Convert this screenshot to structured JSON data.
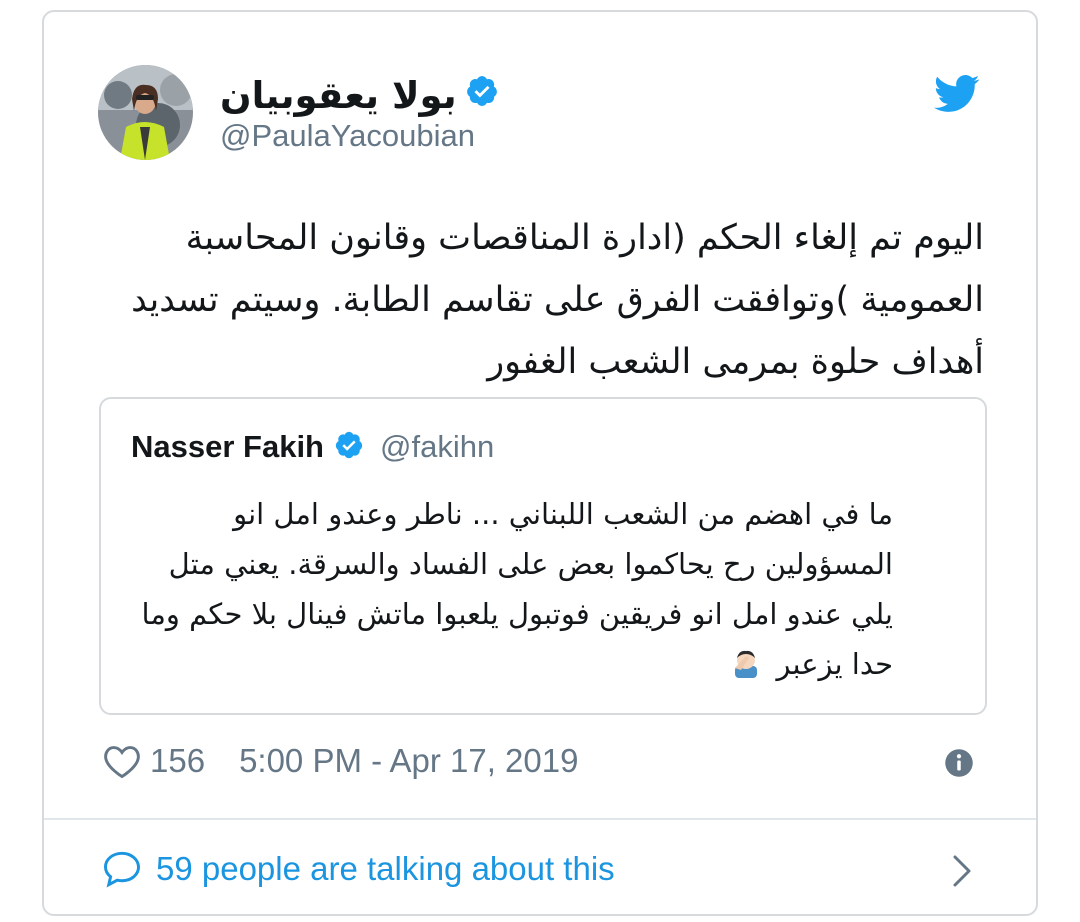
{
  "tweet": {
    "author_name": "بولا يعقوبيان",
    "author_handle": "@PaulaYacoubian",
    "text": "اليوم تم إلغاء الحكم (ادارة المناقصات وقانون المحاسبة العمومية )وتوافقت الفرق على تقاسم الطابة. وسيتم تسديد أهداف حلوة بمرمى الشعب الغفور",
    "likes": "156",
    "timestamp": "5:00 PM - Apr 17, 2019",
    "talking": "59 people are talking about this"
  },
  "quoted": {
    "author_name": "Nasser Fakih",
    "author_handle": "@fakihn",
    "text": "ما في اهضم من الشعب اللبناني ... ناطر وعندو امل انو المسؤولين رح يحاكموا بعض على الفساد والسرقة. يعني متل يلي عندو امل انو فريقين فوتبول يلعبوا ماتش فينال بلا حكم وما حدا يزعبر"
  },
  "icons": {
    "verified": "verified-badge-icon",
    "twitter": "twitter-bird-icon",
    "like": "heart-icon",
    "info": "info-icon",
    "reply": "speech-bubble-icon",
    "chevron": "chevron-right-icon",
    "emoji": "facepalm-emoji-icon"
  },
  "colors": {
    "brand": "#1da1f2",
    "text": "#14171a",
    "secondary": "#657786",
    "link": "#1b95e0",
    "border": "#d6dadd"
  }
}
